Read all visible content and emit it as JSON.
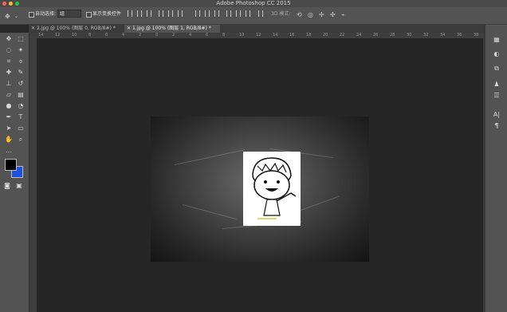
{
  "window": {
    "title": "Adobe Photoshop CC 2015",
    "traffic_lights": [
      "#ff5f57",
      "#febc2e",
      "#28c840"
    ]
  },
  "options_bar": {
    "move_tool_icon": "move-icon",
    "auto_select_label": "自动选择:",
    "auto_select_value": "组",
    "show_transform_label": "显示变换控件",
    "mode_3d_label": "3D 模式:"
  },
  "tabs": [
    {
      "label": "2.jpg @ 100% (图层 0, RGB/8#) *",
      "active": false
    },
    {
      "label": "1.jpg @ 100% (图层 1, RGB/8#) *",
      "active": true
    }
  ],
  "ruler_top": [
    "14",
    "12",
    "10",
    "8",
    "6",
    "4",
    "2",
    "0",
    "2",
    "4",
    "6",
    "8",
    "10",
    "12",
    "14",
    "16",
    "18",
    "20",
    "22",
    "24",
    "26",
    "28",
    "30",
    "32",
    "34",
    "36",
    "38"
  ],
  "tools": [
    "move-icon",
    "marquee-icon",
    "lasso-icon",
    "magic-wand-icon",
    "crop-icon",
    "eyedropper-icon",
    "healing-icon",
    "brush-icon",
    "stamp-icon",
    "history-brush-icon",
    "eraser-icon",
    "gradient-icon",
    "blur-icon",
    "dodge-icon",
    "pen-icon",
    "type-icon",
    "path-select-icon",
    "shape-icon",
    "hand-icon",
    "zoom-icon"
  ],
  "colors": {
    "foreground": "#000000",
    "background_swatch": "#1f4fe0",
    "chalkboard": "#4a4a4a",
    "app_bg": "#282828"
  },
  "right_panel_icons": [
    "layers-icon",
    "adjust-icon",
    "history-icon",
    "brush-settings-icon",
    "properties-icon",
    "character-icon",
    "paragraph-icon"
  ]
}
